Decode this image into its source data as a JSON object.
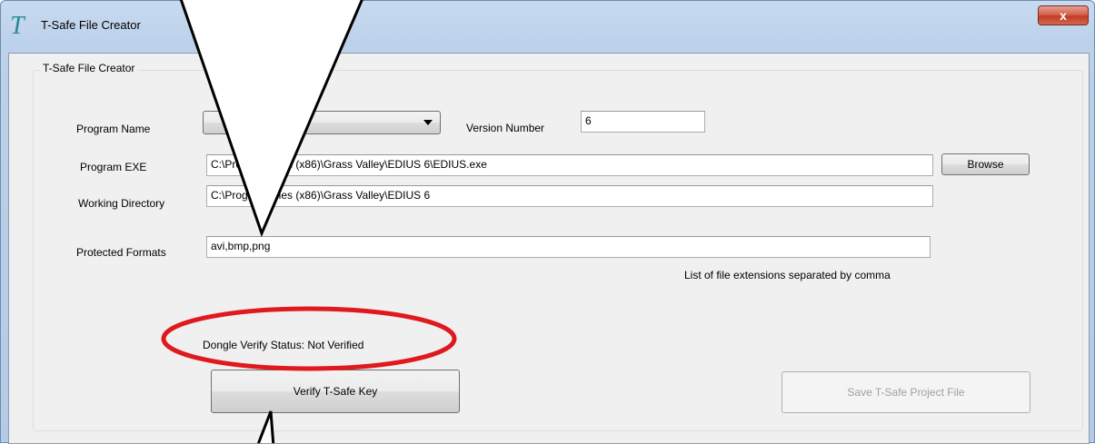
{
  "window": {
    "title": "T-Safe File Creator",
    "close_label": "x",
    "app_icon": "T"
  },
  "group": {
    "title": "T-Safe File Creator"
  },
  "form": {
    "program_name": {
      "label": "Program Name",
      "value": ""
    },
    "version_number": {
      "label": "Version Number",
      "value": "6"
    },
    "program_exe": {
      "label": "Program EXE",
      "value": "C:\\Program Files (x86)\\Grass Valley\\EDIUS 6\\EDIUS.exe"
    },
    "browse_label": "Browse",
    "working_directory": {
      "label": "Working Directory",
      "value": "C:\\Program Files (x86)\\Grass Valley\\EDIUS 6"
    },
    "protected_formats": {
      "label": "Protected Formats",
      "value": "avi,bmp,png",
      "hint": "List of file extensions separated by comma"
    }
  },
  "status": {
    "text": "Dongle Verify Status: Not Verified"
  },
  "buttons": {
    "verify": "Verify T-Safe Key",
    "save": "Save T-Safe Project File"
  },
  "annotation": {
    "ellipse_color": "#e0191f",
    "callout_stroke": "#000000"
  }
}
